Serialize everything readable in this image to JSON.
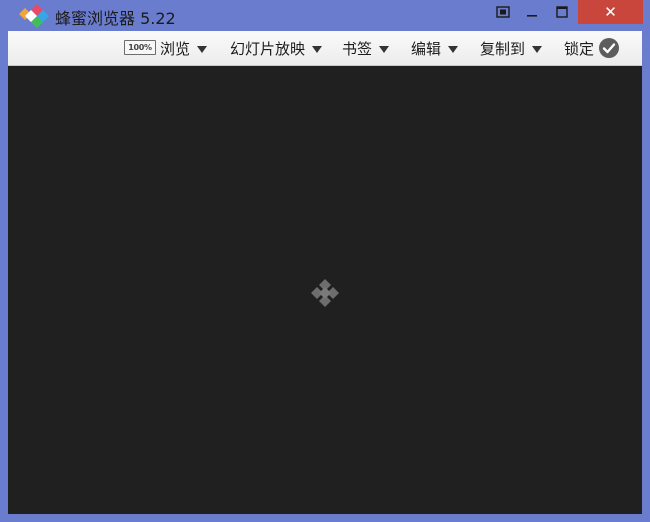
{
  "app": {
    "title": "蜂蜜浏览器 5.22",
    "logo_icon": "honeyview-logo-icon"
  },
  "window_controls": {
    "fullscreen_icon": "fullscreen-icon",
    "minimize_icon": "minimize-icon",
    "maximize_icon": "maximize-icon",
    "close_label": "✕",
    "close_color": "#c9463d"
  },
  "toolbar": {
    "zoom_badge": "100%",
    "menu": [
      {
        "label": "浏览"
      },
      {
        "label": "幻灯片放映"
      },
      {
        "label": "书签"
      },
      {
        "label": "编辑"
      },
      {
        "label": "复制到"
      }
    ],
    "lock_label": "锁定",
    "lock_icon": "checkmark-circle-icon"
  },
  "viewer": {
    "background": "#202020",
    "loading_icon": "loading-diamond-icon"
  },
  "colors": {
    "frame": "#6a7ccd",
    "toolbar": "#efefef",
    "close_button": "#c9463d"
  }
}
